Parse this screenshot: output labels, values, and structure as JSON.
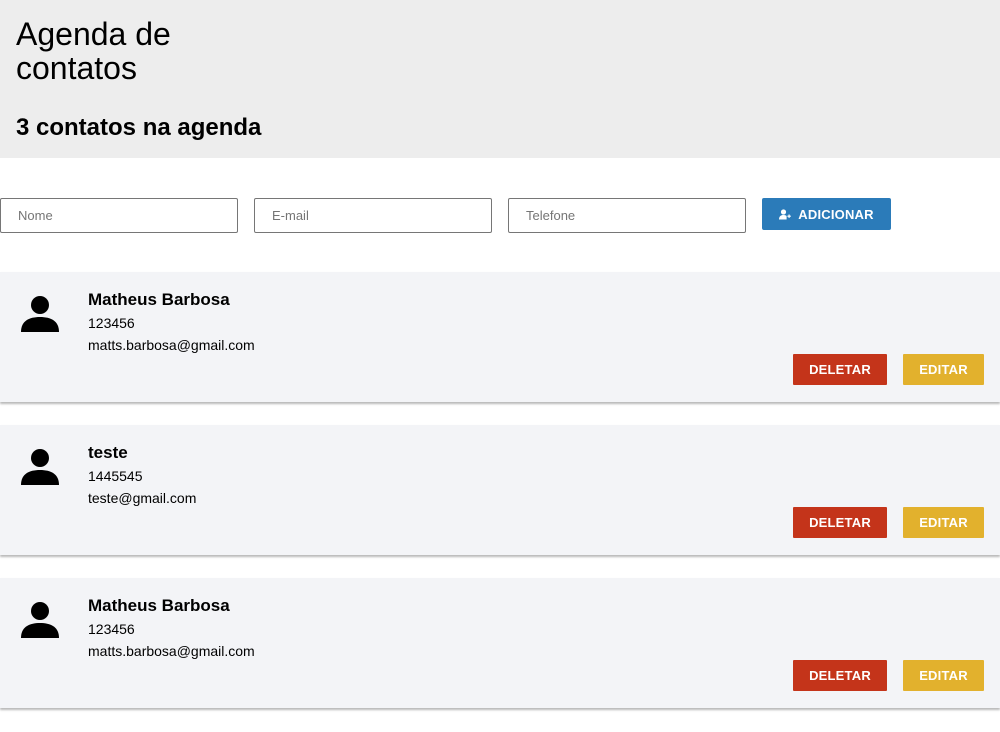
{
  "header": {
    "title": "Agenda de contatos",
    "count_text": "3 contatos na agenda"
  },
  "form": {
    "name_placeholder": "Nome",
    "email_placeholder": "E-mail",
    "phone_placeholder": "Telefone",
    "add_label": "ADICIONAR",
    "add_icon": "add-user-icon"
  },
  "colors": {
    "header_bg": "#ededed",
    "card_bg": "#f3f4f7",
    "add_button": "#2b7bb9",
    "delete_button": "#c4341a",
    "edit_button": "#e2b12d"
  },
  "contacts": [
    {
      "name": "Matheus Barbosa",
      "phone": "123456",
      "email": "matts.barbosa@gmail.com",
      "delete_label": "DELETAR",
      "edit_label": "EDITAR",
      "icon": "person-icon"
    },
    {
      "name": "teste",
      "phone": "1445545",
      "email": "teste@gmail.com",
      "delete_label": "DELETAR",
      "edit_label": "EDITAR",
      "icon": "person-icon"
    },
    {
      "name": "Matheus Barbosa",
      "phone": "123456",
      "email": "matts.barbosa@gmail.com",
      "delete_label": "DELETAR",
      "edit_label": "EDITAR",
      "icon": "person-icon"
    }
  ]
}
